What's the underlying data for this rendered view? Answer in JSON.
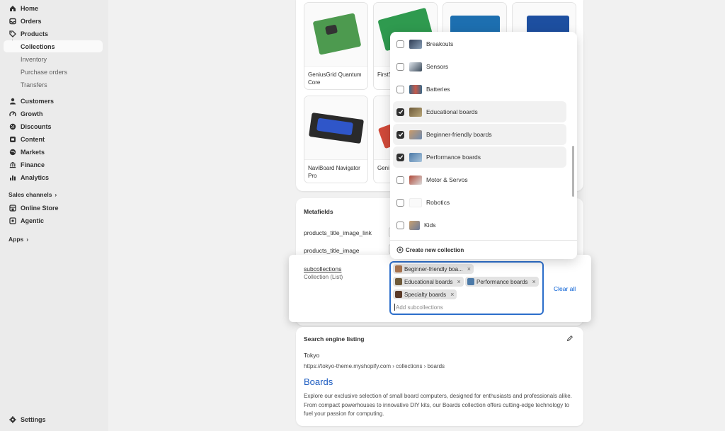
{
  "sidebar": {
    "items": [
      {
        "label": "Home",
        "icon": "home-icon"
      },
      {
        "label": "Orders",
        "icon": "orders-icon"
      },
      {
        "label": "Products",
        "icon": "tag-icon"
      }
    ],
    "products_sub": [
      "Collections",
      "Inventory",
      "Purchase orders",
      "Transfers"
    ],
    "items2": [
      {
        "label": "Customers",
        "icon": "person-icon"
      },
      {
        "label": "Growth",
        "icon": "growth-icon"
      },
      {
        "label": "Discounts",
        "icon": "discount-icon"
      },
      {
        "label": "Content",
        "icon": "content-icon"
      },
      {
        "label": "Markets",
        "icon": "globe-icon"
      },
      {
        "label": "Finance",
        "icon": "finance-icon"
      },
      {
        "label": "Analytics",
        "icon": "chart-icon"
      }
    ],
    "sales_channels_label": "Sales channels",
    "channels": [
      {
        "label": "Online Store",
        "icon": "store-icon"
      },
      {
        "label": "Agentic",
        "icon": "agentic-icon"
      }
    ],
    "apps_label": "Apps",
    "settings_label": "Settings"
  },
  "products": [
    {
      "name": "GeniusGrid Quantum Core"
    },
    {
      "name": "FirstS Modu"
    },
    {
      "name": "NaviBoard Navigator Pro"
    },
    {
      "name": "Geni Editi"
    }
  ],
  "metafields": {
    "title": "Metafields",
    "keys": [
      "products_title_image_link",
      "products_title_image"
    ],
    "subcollections_key": "subcollections",
    "subcollections_type": "Collection (List)",
    "tags": [
      "Beginner-friendly boa...",
      "Educational boards",
      "Performance boards",
      "Specialty boards"
    ],
    "input_placeholder": "Add subcollections",
    "clear_all": "Clear all"
  },
  "dropdown": {
    "options": [
      {
        "label": "Breakouts",
        "checked": false
      },
      {
        "label": "Sensors",
        "checked": false
      },
      {
        "label": "Batteries",
        "checked": false
      },
      {
        "label": "Educational boards",
        "checked": true
      },
      {
        "label": "Beginner-friendly boards",
        "checked": true
      },
      {
        "label": "Performance boards",
        "checked": true
      },
      {
        "label": "Motor & Servos",
        "checked": false
      },
      {
        "label": "Robotics",
        "checked": false
      },
      {
        "label": "Kids",
        "checked": false
      }
    ],
    "create_label": "Create new collection"
  },
  "seo": {
    "title": "Search engine listing",
    "store": "Tokyo",
    "url": "https://tokyo-theme.myshopify.com › collections › boards",
    "page_title": "Boards",
    "description": "Explore our exclusive selection of small board computers, designed for enthusiasts and professionals alike. From compact powerhouses to innovative DIY kits, our Boards collection offers cutting-edge technology to fuel your passion for computing."
  },
  "colors": {
    "accent": "#005bd3",
    "focus": "#2c6ecb"
  }
}
